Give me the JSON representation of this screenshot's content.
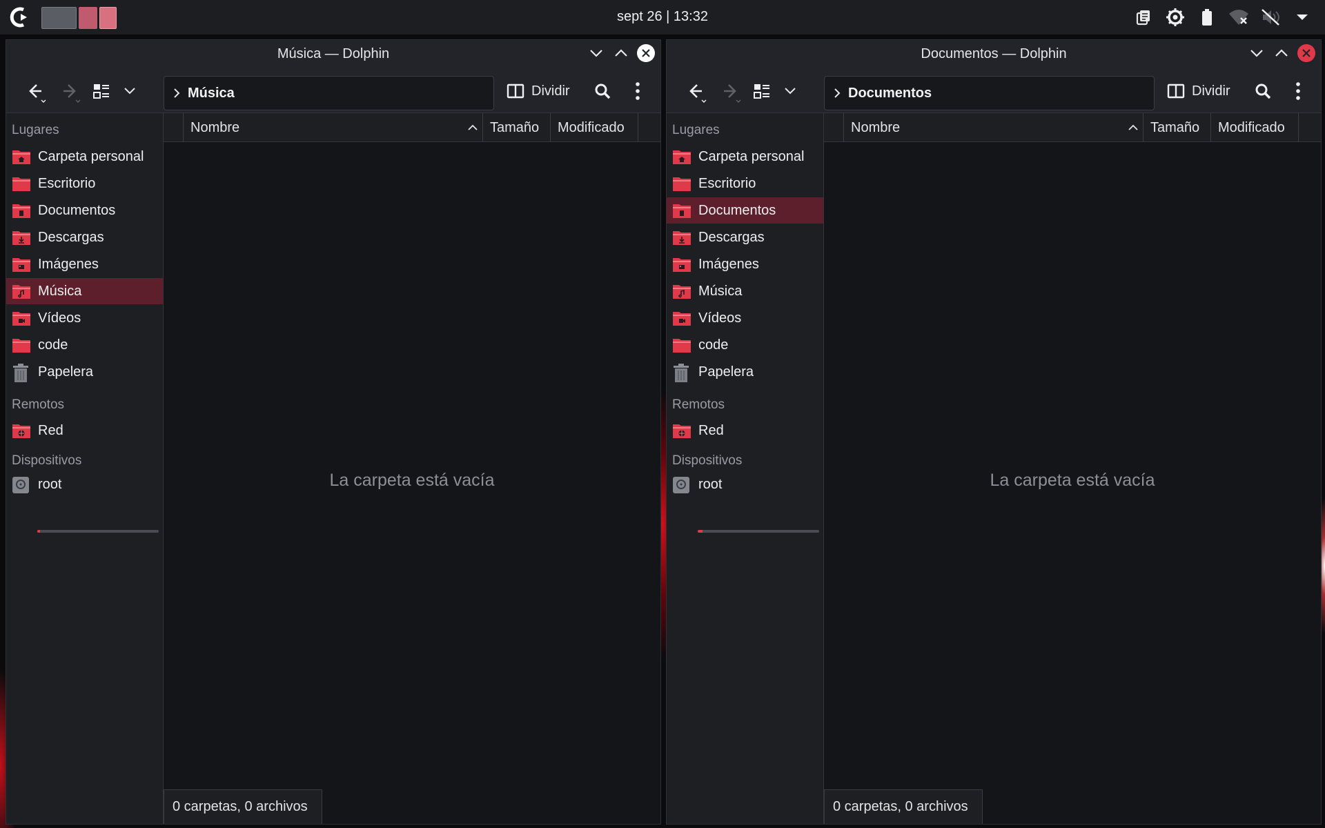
{
  "panel": {
    "clock": "sept 26 | 13:32",
    "tray_icons": [
      "clipboard-icon",
      "brightness-icon",
      "battery-icon",
      "wifi-off-icon",
      "volume-muted-icon",
      "tray-expand-icon"
    ]
  },
  "colors": {
    "accent": "#e0394a",
    "active_place": "#5c1f2b"
  },
  "windows": [
    {
      "title": "Música — Dolphin",
      "location": "Música",
      "split_label": "Dividir",
      "sidebar": {
        "places_header": "Lugares",
        "places": [
          {
            "label": "Carpeta personal",
            "icon": "home-folder-icon"
          },
          {
            "label": "Escritorio",
            "icon": "desktop-folder-icon"
          },
          {
            "label": "Documentos",
            "icon": "documents-folder-icon"
          },
          {
            "label": "Descargas",
            "icon": "downloads-folder-icon"
          },
          {
            "label": "Imágenes",
            "icon": "pictures-folder-icon"
          },
          {
            "label": "Música",
            "icon": "music-folder-icon",
            "active": true
          },
          {
            "label": "Vídeos",
            "icon": "videos-folder-icon"
          },
          {
            "label": "code",
            "icon": "folder-icon"
          },
          {
            "label": "Papelera",
            "icon": "trash-icon"
          }
        ],
        "remote_header": "Remotos",
        "remote": [
          {
            "label": "Red",
            "icon": "network-folder-icon"
          }
        ],
        "devices_header": "Dispositivos",
        "devices": [
          {
            "label": "root",
            "icon": "drive-icon",
            "usage": 0.02
          }
        ]
      },
      "columns": [
        "Nombre",
        "Tamaño",
        "Modificado"
      ],
      "empty_message": "La carpeta está vacía",
      "status": "0 carpetas, 0 archivos"
    },
    {
      "title": "Documentos — Dolphin",
      "location": "Documentos",
      "split_label": "Dividir",
      "sidebar": {
        "places_header": "Lugares",
        "places": [
          {
            "label": "Carpeta personal",
            "icon": "home-folder-icon"
          },
          {
            "label": "Escritorio",
            "icon": "desktop-folder-icon"
          },
          {
            "label": "Documentos",
            "icon": "documents-folder-icon",
            "active": true
          },
          {
            "label": "Descargas",
            "icon": "downloads-folder-icon"
          },
          {
            "label": "Imágenes",
            "icon": "pictures-folder-icon"
          },
          {
            "label": "Música",
            "icon": "music-folder-icon"
          },
          {
            "label": "Vídeos",
            "icon": "videos-folder-icon"
          },
          {
            "label": "code",
            "icon": "folder-icon"
          },
          {
            "label": "Papelera",
            "icon": "trash-icon"
          }
        ],
        "remote_header": "Remotos",
        "remote": [
          {
            "label": "Red",
            "icon": "network-folder-icon"
          }
        ],
        "devices_header": "Dispositivos",
        "devices": [
          {
            "label": "root",
            "icon": "drive-icon",
            "usage": 0.04
          }
        ]
      },
      "columns": [
        "Nombre",
        "Tamaño",
        "Modificado"
      ],
      "empty_message": "La carpeta está vacía",
      "status": "0 carpetas, 0 archivos"
    }
  ]
}
